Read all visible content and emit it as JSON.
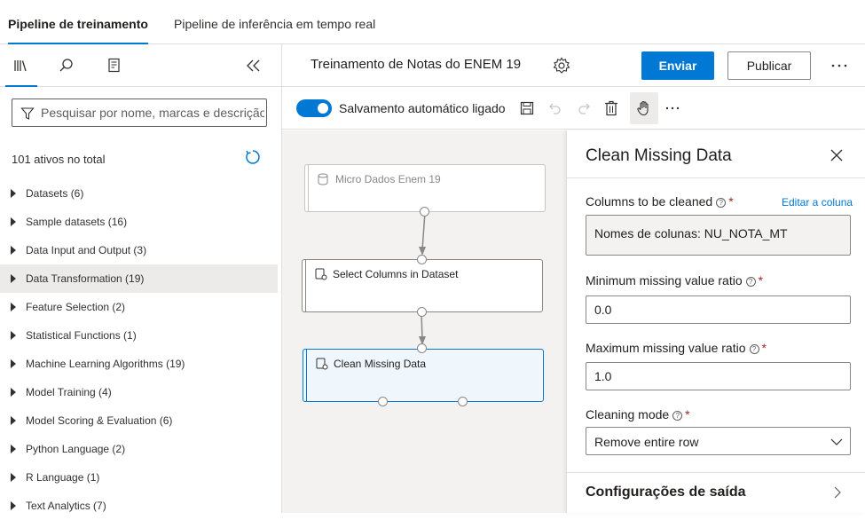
{
  "tabs": [
    "Pipeline de treinamento",
    "Pipeline de inferência em tempo real"
  ],
  "left_panel": {
    "icons": [
      "library-icon",
      "search-icon",
      "data-list-icon"
    ],
    "collapse_icon": "double-chevron-left-icon",
    "search_placeholder": "Pesquisar por nome, marcas e descrição",
    "assets_count": "101 ativos no total",
    "categories": [
      "Datasets (6)",
      "Sample datasets (16)",
      "Data Input and Output (3)",
      "Data Transformation (19)",
      "Feature Selection (2)",
      "Statistical Functions (1)",
      "Machine Learning Algorithms (19)",
      "Model Training (4)",
      "Model Scoring & Evaluation (6)",
      "Python Language (2)",
      "R Language (1)",
      "Text Analytics (7)"
    ],
    "highlighted_category": "Data Transformation (19)"
  },
  "header": {
    "title": "Treinamento de Notas do ENEM 19",
    "submit": "Enviar",
    "publish": "Publicar"
  },
  "toolbar": {
    "autosave_label": "Salvamento automático ligado",
    "autosave_on": true
  },
  "canvas": {
    "nodes": [
      "Micro Dados Enem 19",
      "Select Columns in Dataset",
      "Clean Missing Data"
    ],
    "selected_node": "Clean Missing Data"
  },
  "right_panel": {
    "title": "Clean Missing Data",
    "columns_label": "Columns to be cleaned",
    "edit_column": "Editar a coluna",
    "columns_value": "Nomes de colunas: NU_NOTA_MT",
    "min_label": "Minimum missing value ratio",
    "min_value": "0.0",
    "max_label": "Maximum missing value ratio",
    "max_value": "1.0",
    "mode_label": "Cleaning mode",
    "mode_value": "Remove entire row",
    "output_section": "Configurações de saída",
    "required_mark": "*",
    "help_glyph": "?"
  },
  "colors": {
    "accent": "#0078d4",
    "canvas_bg": "#f3f2f1",
    "highlight_bg": "#edebe9"
  }
}
